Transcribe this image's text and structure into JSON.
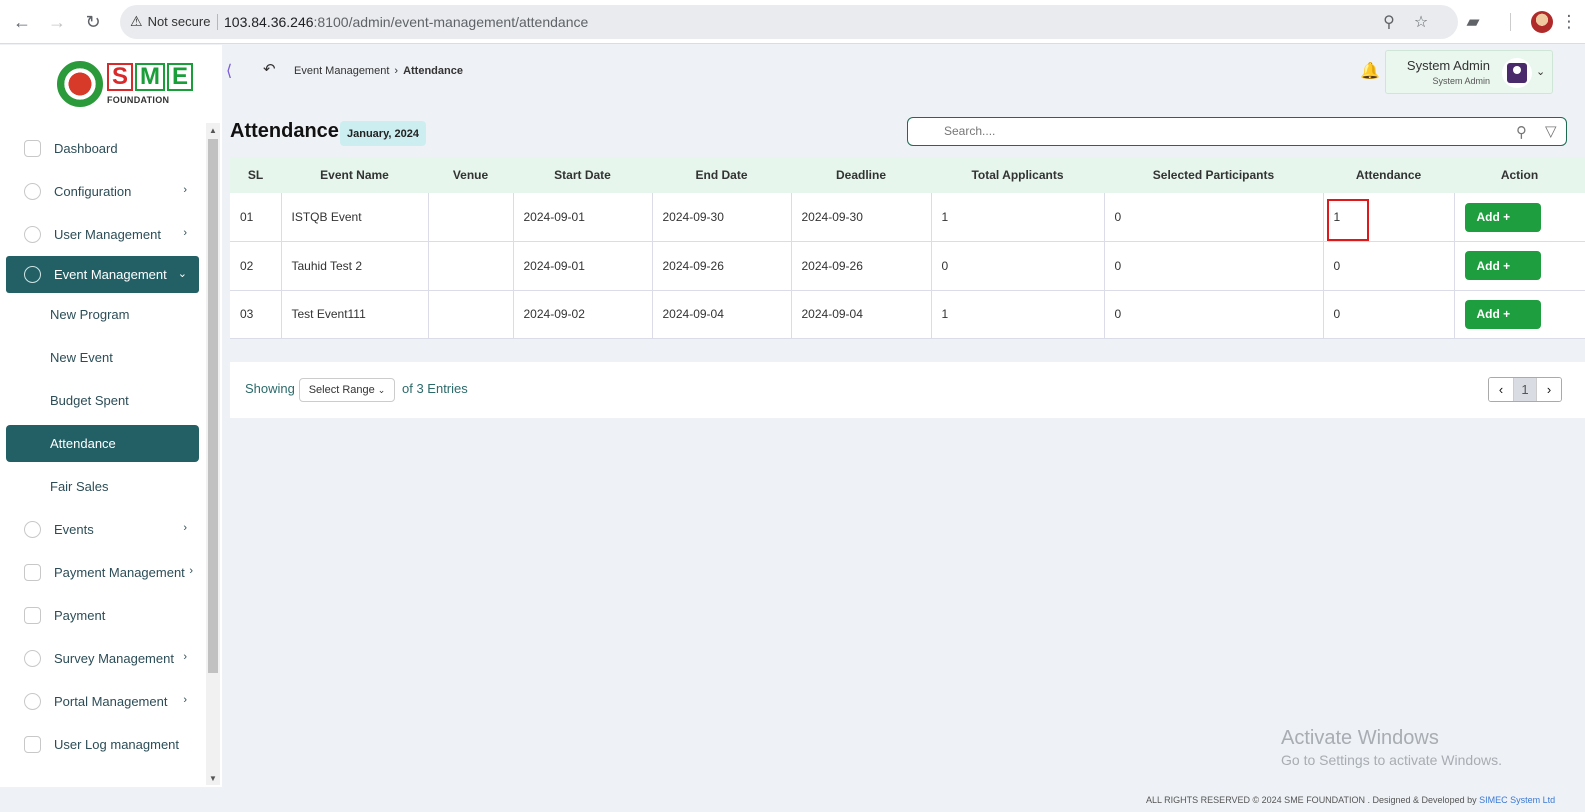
{
  "browser": {
    "security": "Not secure",
    "url_host": "103.84.36.246",
    "url_rest": ":8100/admin/event-management/attendance"
  },
  "sidebar": {
    "logo_text": "SME",
    "logo_sub": "FOUNDATION",
    "items": [
      {
        "label": "Dashboard"
      },
      {
        "label": "Configuration"
      },
      {
        "label": "User Management"
      },
      {
        "label": "Event Management"
      },
      {
        "label": "Events"
      },
      {
        "label": "Payment Management"
      },
      {
        "label": "Payment"
      },
      {
        "label": "Survey Management"
      },
      {
        "label": "Portal Management"
      },
      {
        "label": "User Log managment"
      }
    ],
    "sub_items": [
      {
        "label": "New Program"
      },
      {
        "label": "New Event"
      },
      {
        "label": "Budget Spent"
      },
      {
        "label": "Attendance"
      },
      {
        "label": "Fair Sales"
      }
    ]
  },
  "header": {
    "breadcrumb_parent": "Event Management",
    "breadcrumb_current": "Attendance",
    "user_name": "System Admin",
    "user_role": "System Admin"
  },
  "main": {
    "title": "Attendance",
    "month": "January, 2024",
    "search_placeholder": "Search....",
    "columns": [
      "SL",
      "Event Name",
      "Venue",
      "Start Date",
      "End Date",
      "Deadline",
      "Total Applicants",
      "Selected Participants",
      "Attendance",
      "Action"
    ],
    "rows": [
      {
        "sl": "01",
        "event": "ISTQB Event",
        "venue": "",
        "start": "2024-09-01",
        "end": "2024-09-30",
        "deadline": "2024-09-30",
        "total": "1",
        "selected": "0",
        "attendance": "1",
        "action": "Add +"
      },
      {
        "sl": "02",
        "event": "Tauhid Test 2",
        "venue": "",
        "start": "2024-09-01",
        "end": "2024-09-26",
        "deadline": "2024-09-26",
        "total": "0",
        "selected": "0",
        "attendance": "0",
        "action": "Add +"
      },
      {
        "sl": "03",
        "event": "Test Event111",
        "venue": "",
        "start": "2024-09-02",
        "end": "2024-09-04",
        "deadline": "2024-09-04",
        "total": "1",
        "selected": "0",
        "attendance": "0",
        "action": "Add +"
      }
    ],
    "showing_label": "Showing",
    "range_select": "Select Range",
    "entries_label": "of 3 Entries",
    "current_page": "1"
  },
  "watermark": {
    "line1": "Activate Windows",
    "line2": "Go to Settings to activate Windows."
  },
  "footer": {
    "text": "ALL RIGHTS RESERVED © 2024 SME FOUNDATION . Designed & Developed by",
    "brand": "SIMEC System Ltd"
  },
  "colors": {
    "primary": "#236066",
    "button_green": "#1e9e3e",
    "table_header": "#e6f6ec",
    "highlight": "#e01818"
  }
}
